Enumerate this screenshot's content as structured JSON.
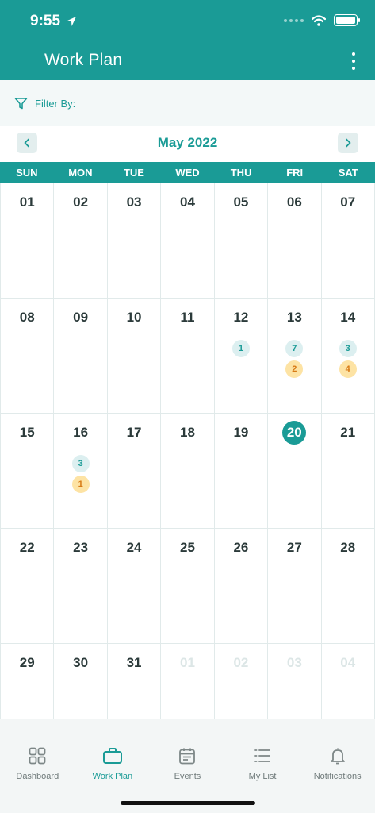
{
  "status": {
    "time": "9:55"
  },
  "app": {
    "title": "Work Plan"
  },
  "filter": {
    "label": "Filter By:"
  },
  "calendar": {
    "month": "May 2022",
    "weekdays": [
      "SUN",
      "MON",
      "TUE",
      "WED",
      "THU",
      "FRI",
      "SAT"
    ],
    "weeks": [
      [
        {
          "day": "01"
        },
        {
          "day": "02"
        },
        {
          "day": "03"
        },
        {
          "day": "04"
        },
        {
          "day": "05"
        },
        {
          "day": "06"
        },
        {
          "day": "07"
        }
      ],
      [
        {
          "day": "08"
        },
        {
          "day": "09"
        },
        {
          "day": "10"
        },
        {
          "day": "11"
        },
        {
          "day": "12",
          "badges": [
            {
              "count": "1",
              "color": "teal"
            }
          ]
        },
        {
          "day": "13",
          "badges": [
            {
              "count": "7",
              "color": "teal"
            },
            {
              "count": "2",
              "color": "orange"
            }
          ]
        },
        {
          "day": "14",
          "badges": [
            {
              "count": "3",
              "color": "teal"
            },
            {
              "count": "4",
              "color": "orange"
            }
          ]
        }
      ],
      [
        {
          "day": "15"
        },
        {
          "day": "16",
          "badges": [
            {
              "count": "3",
              "color": "teal"
            },
            {
              "count": "1",
              "color": "orange"
            }
          ]
        },
        {
          "day": "17"
        },
        {
          "day": "18"
        },
        {
          "day": "19"
        },
        {
          "day": "20",
          "today": true
        },
        {
          "day": "21"
        }
      ],
      [
        {
          "day": "22"
        },
        {
          "day": "23"
        },
        {
          "day": "24"
        },
        {
          "day": "25"
        },
        {
          "day": "26"
        },
        {
          "day": "27"
        },
        {
          "day": "28"
        }
      ],
      [
        {
          "day": "29"
        },
        {
          "day": "30"
        },
        {
          "day": "31"
        },
        {
          "day": "01",
          "other_month": true
        },
        {
          "day": "02",
          "other_month": true
        },
        {
          "day": "03",
          "other_month": true
        },
        {
          "day": "04",
          "other_month": true
        }
      ]
    ]
  },
  "tabs": [
    {
      "label": "Dashboard",
      "icon": "dashboard-icon",
      "active": false
    },
    {
      "label": "Work Plan",
      "icon": "briefcase-icon",
      "active": true
    },
    {
      "label": "Events",
      "icon": "calendar-icon",
      "active": false
    },
    {
      "label": "My List",
      "icon": "list-icon",
      "active": false
    },
    {
      "label": "Notifications",
      "icon": "bell-icon",
      "active": false
    }
  ],
  "colors": {
    "primary": "#1a9b96",
    "badge_teal_bg": "#dceff0",
    "badge_orange_bg": "#fde3a4"
  }
}
